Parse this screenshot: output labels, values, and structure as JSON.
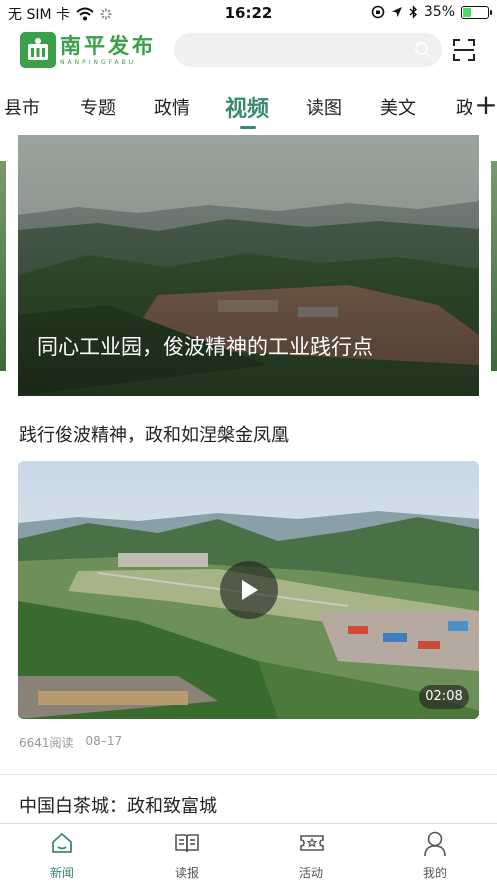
{
  "status_bar": {
    "carrier": "无 SIM 卡",
    "time": "16:22",
    "battery": "35%",
    "battery_level": 0.35
  },
  "header": {
    "logo_name": "南平发布",
    "logo_sub": "NANPINGFABU",
    "search_placeholder": ""
  },
  "tabs": [
    {
      "label": "县市"
    },
    {
      "label": "专题"
    },
    {
      "label": "政情"
    },
    {
      "label": "视频",
      "active": true
    },
    {
      "label": "读图"
    },
    {
      "label": "美文"
    },
    {
      "label": "政"
    }
  ],
  "carousel": {
    "caption": "同心工业园，俊波精神的工业践行点"
  },
  "articles": [
    {
      "title": "践行俊波精神，政和如涅槃金凤凰",
      "duration": "02:08",
      "reads": "6641阅读",
      "date": "08–17"
    },
    {
      "title": "中国白茶城：政和致富城"
    }
  ],
  "bottom_nav": [
    {
      "label": "新闻",
      "icon": "home-icon",
      "active": true
    },
    {
      "label": "读报",
      "icon": "newspaper-icon"
    },
    {
      "label": "活动",
      "icon": "ticket-icon"
    },
    {
      "label": "我的",
      "icon": "user-icon"
    }
  ],
  "colors": {
    "accent": "#3a8a6b",
    "brand": "#3aa04a"
  }
}
